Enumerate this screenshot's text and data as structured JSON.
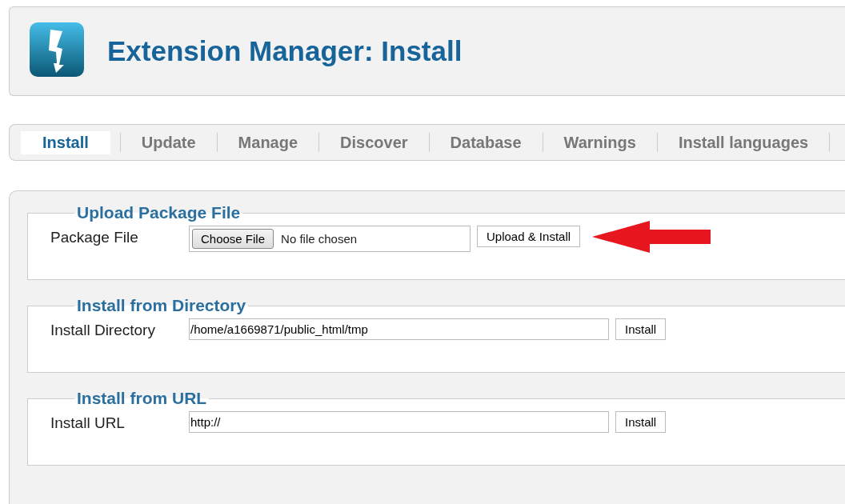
{
  "header": {
    "title": "Extension Manager: Install"
  },
  "tabs": [
    {
      "label": "Install",
      "selected": true
    },
    {
      "label": "Update",
      "selected": false
    },
    {
      "label": "Manage",
      "selected": false
    },
    {
      "label": "Discover",
      "selected": false
    },
    {
      "label": "Database",
      "selected": false
    },
    {
      "label": "Warnings",
      "selected": false
    },
    {
      "label": "Install languages",
      "selected": false
    }
  ],
  "sections": [
    {
      "kind": "file",
      "legend": "Upload Package File",
      "label": "Package File",
      "choose_button": "Choose File",
      "file_status": "No file chosen",
      "button": "Upload & Install",
      "pointer_arrow": true
    },
    {
      "kind": "text",
      "legend": "Install from Directory",
      "label": "Install Directory",
      "value": "/home/a1669871/public_html/tmp",
      "button": "Install"
    },
    {
      "kind": "text",
      "legend": "Install from URL",
      "label": "Install URL",
      "value": "http://",
      "button": "Install"
    }
  ]
}
